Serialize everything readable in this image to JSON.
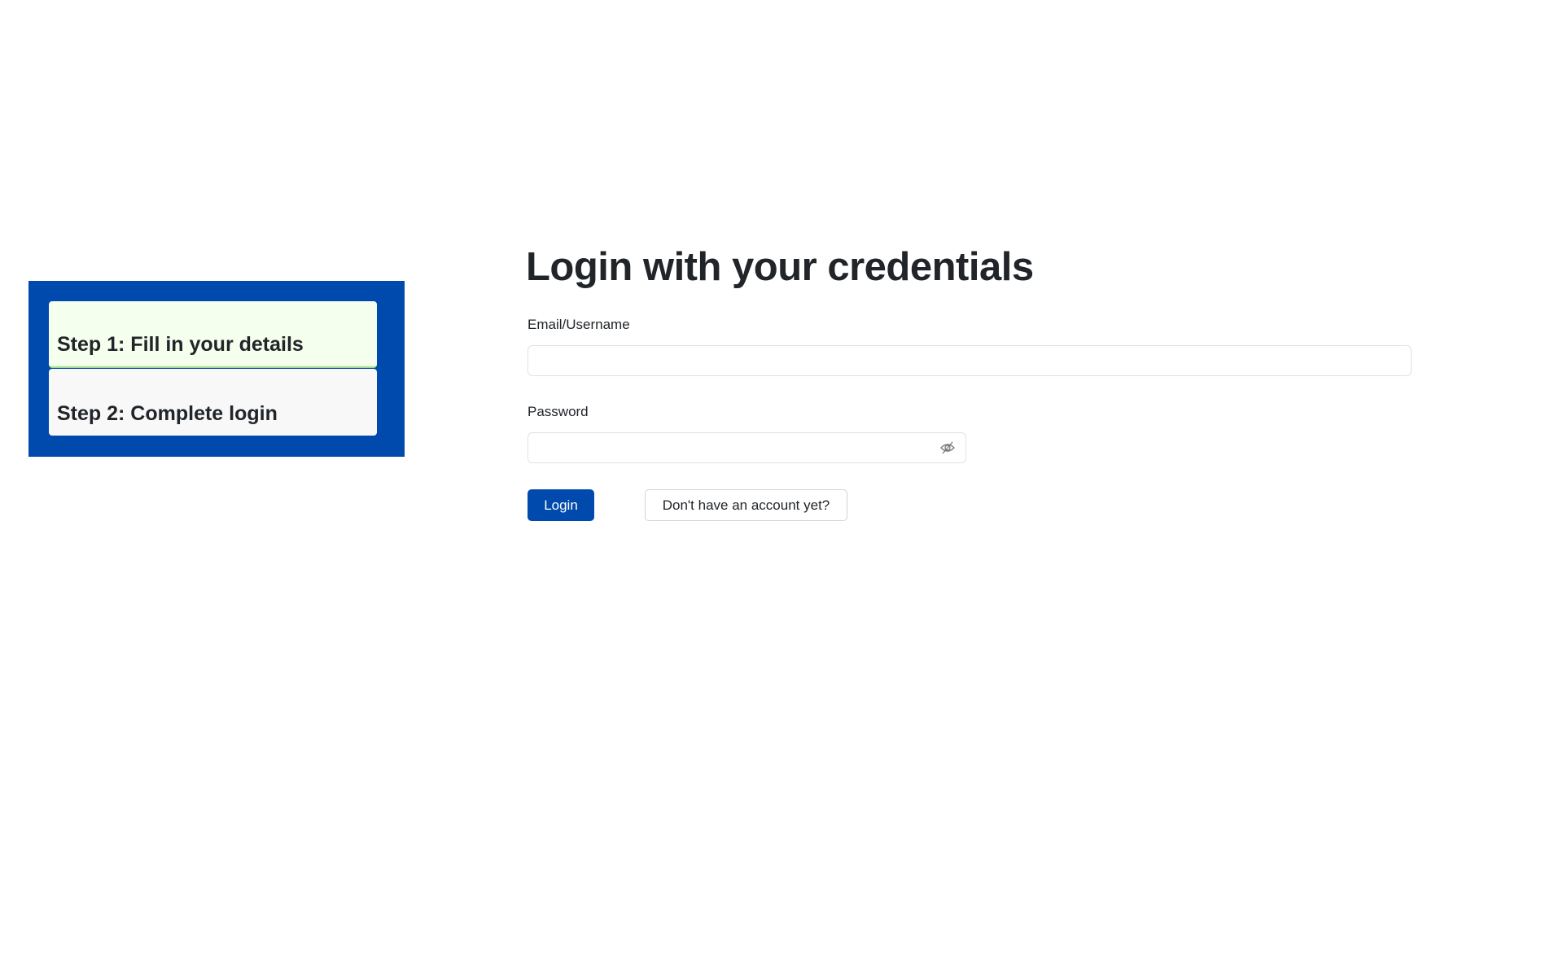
{
  "colors": {
    "accent": "#004aad",
    "step_active_bg": "#f4ffee",
    "step_inactive_bg": "#f8f8f8"
  },
  "steps": [
    {
      "label": "Step 1: Fill in your details",
      "active": true
    },
    {
      "label": "Step 2: Complete login",
      "active": false
    }
  ],
  "form": {
    "title": "Login with your credentials",
    "email_label": "Email/Username",
    "email_value": "",
    "password_label": "Password",
    "password_value": "",
    "password_toggle_icon": "eye-slash-icon",
    "login_label": "Login",
    "signup_label": "Don't have an account yet?"
  }
}
